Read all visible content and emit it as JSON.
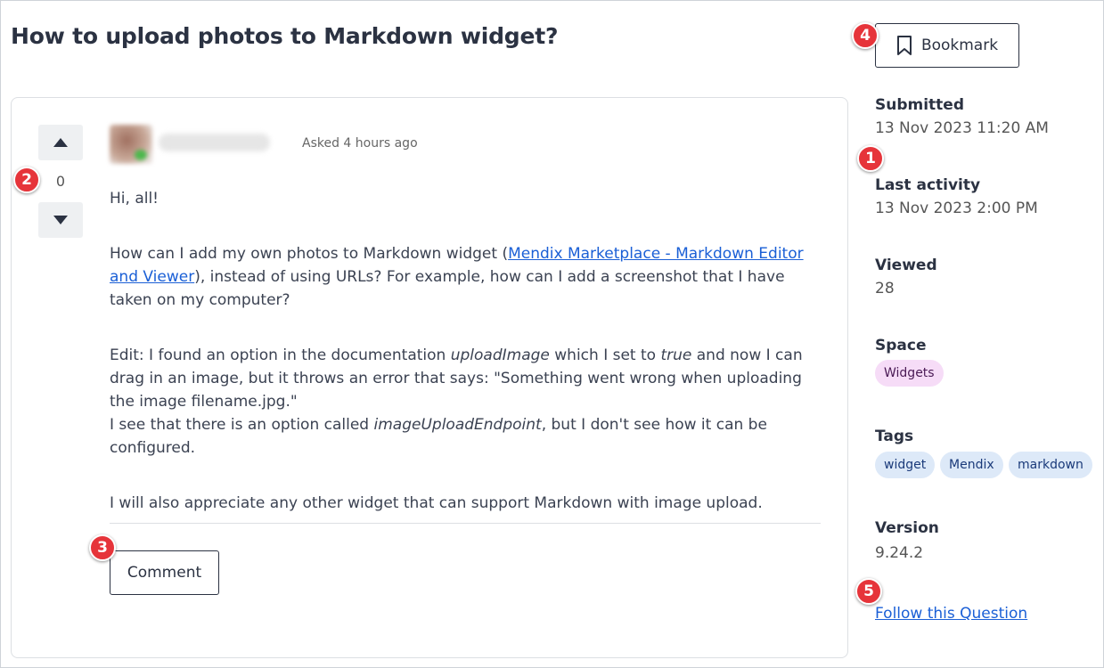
{
  "question": {
    "title": "How to upload photos to Markdown widget?",
    "vote_count": "0",
    "asked": "Asked 4 hours ago",
    "body": {
      "p1": "Hi, all!",
      "p2_pre": "How can I add my own photos to Markdown widget (",
      "p2_link": "Mendix Marketplace - Markdown Editor and Viewer",
      "p2_post": "), instead of using URLs? For example, how can I add a screenshot that I have taken on my computer?",
      "p3_a": "Edit: I found an option in the documentation ",
      "p3_em1": "uploadImage",
      "p3_b": " which I set to ",
      "p3_em2": "true",
      "p3_c": " and now I can drag in an image, but it throws an error that says: \"Something went wrong when uploading the image filename.jpg.\"",
      "p4_a": "I see that there is an option called ",
      "p4_em": "imageUploadEndpoint",
      "p4_b": ", but I don't see how it can be configured.",
      "p5": "I will also appreciate any other widget that can support Markdown with image upload."
    },
    "comment_label": "Comment"
  },
  "sidebar": {
    "bookmark_label": "Bookmark",
    "submitted_label": "Submitted",
    "submitted_value": "13 Nov 2023 11:20 AM",
    "last_activity_label": "Last activity",
    "last_activity_value": "13 Nov 2023 2:00 PM",
    "viewed_label": "Viewed",
    "viewed_value": "28",
    "space_label": "Space",
    "space_value": "Widgets",
    "tags_label": "Tags",
    "tags": [
      "widget",
      "Mendix",
      "markdown"
    ],
    "version_label": "Version",
    "version_value": "9.24.2",
    "follow_label": "Follow this Question"
  },
  "markers": [
    "1",
    "2",
    "3",
    "4",
    "5"
  ],
  "colors": {
    "marker": "#e6343a",
    "link": "#1a5fd6",
    "space_chip": "#f6dcf7",
    "tag_chip": "#dde9f8"
  },
  "icons": {
    "upvote": "caret-up-icon",
    "downvote": "caret-down-icon",
    "bookmark": "bookmark-icon"
  }
}
